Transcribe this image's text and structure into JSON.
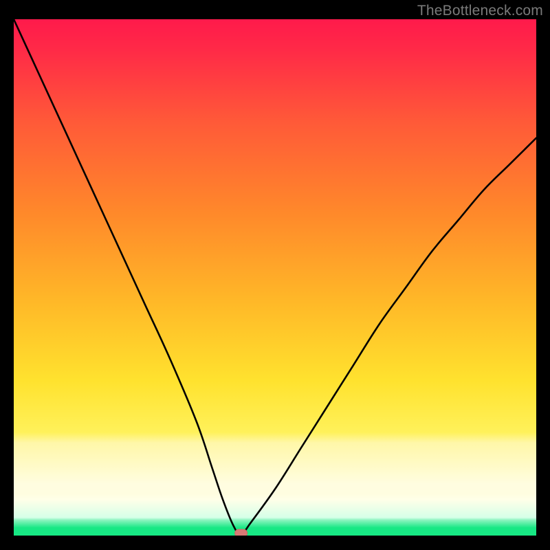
{
  "watermark": "TheBottleneck.com",
  "colors": {
    "frame": "#000000",
    "curve": "#000000",
    "marker_fill": "#d87a76",
    "marker_stroke": "#cc6b66",
    "grad_top": "#ff1a4b",
    "grad_mid1": "#ff8a2a",
    "grad_mid2": "#ffe22e",
    "grad_low": "#fff7a8",
    "grad_green": "#17e884"
  },
  "chart_data": {
    "type": "line",
    "title": "",
    "xlabel": "",
    "ylabel": "",
    "ylim": [
      0,
      100
    ],
    "xlim": [
      0,
      100
    ],
    "series": [
      {
        "name": "bottleneck-curve",
        "x": [
          0,
          5,
          10,
          15,
          20,
          25,
          30,
          35,
          38,
          40,
          42,
          43.5,
          45,
          50,
          55,
          60,
          65,
          70,
          75,
          80,
          85,
          90,
          95,
          100
        ],
        "y": [
          100,
          89,
          78,
          67,
          56,
          45,
          34,
          22,
          13,
          7,
          2,
          0,
          2,
          9,
          17,
          25,
          33,
          41,
          48,
          55,
          61,
          67,
          72,
          77
        ]
      }
    ],
    "marker": {
      "x": 43.5,
      "y": 0
    },
    "gradient_bands_y_pct_from_top": {
      "red_start": 0,
      "orange_mid": 45,
      "yellow_mid": 72,
      "pale_band_top": 82,
      "pale_band_bottom": 92,
      "green_band_top": 97,
      "green_band_bottom": 100
    }
  }
}
